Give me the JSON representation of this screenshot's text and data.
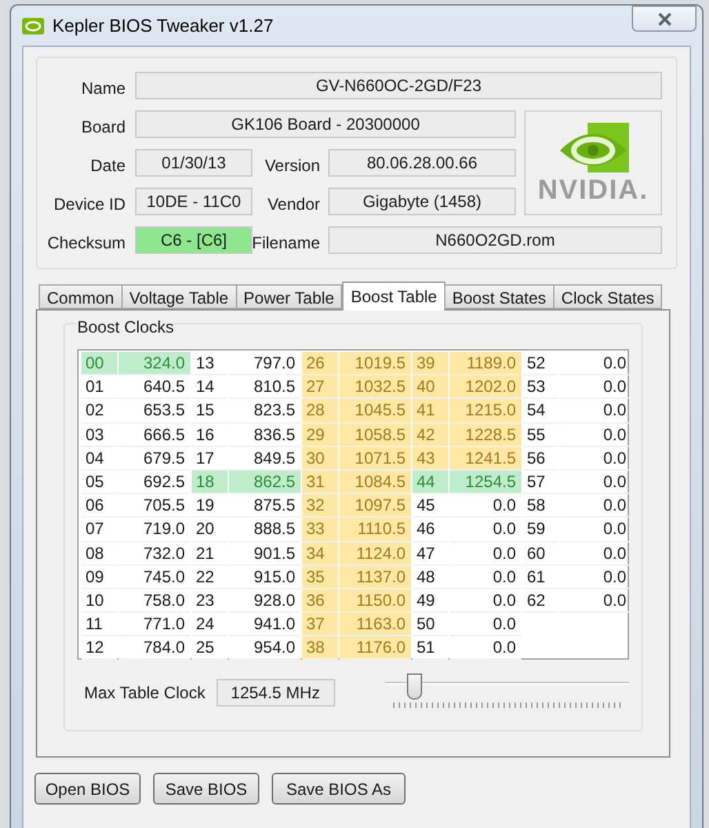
{
  "window": {
    "title": "Kepler BIOS Tweaker v1.27"
  },
  "info": {
    "name": {
      "label": "Name",
      "value": "GV-N660OC-2GD/F23"
    },
    "board": {
      "label": "Board",
      "value": "GK106 Board - 20300000"
    },
    "date": {
      "label": "Date",
      "value": "01/30/13"
    },
    "version": {
      "label": "Version",
      "value": "80.06.28.00.66"
    },
    "device_id": {
      "label": "Device ID",
      "value": "10DE - 11C0"
    },
    "vendor": {
      "label": "Vendor",
      "value": "Gigabyte (1458)"
    },
    "checksum": {
      "label": "Checksum",
      "value": "C6 - [C6]",
      "color": "#8ee68e"
    },
    "filename": {
      "label": "Filename",
      "value": "N660O2GD.rom"
    },
    "logo": {
      "text": "NVIDIA."
    }
  },
  "tabs": [
    {
      "label": "Common",
      "selected": false
    },
    {
      "label": "Voltage Table",
      "selected": false
    },
    {
      "label": "Power Table",
      "selected": false
    },
    {
      "label": "Boost Table",
      "selected": true
    },
    {
      "label": "Boost States",
      "selected": false
    },
    {
      "label": "Clock States",
      "selected": false
    }
  ],
  "boost_clocks": {
    "title": "Boost Clocks",
    "columns": [
      [
        {
          "index": "00",
          "value": "324.0",
          "color": "#bfeccb"
        },
        {
          "index": "01",
          "value": "640.5"
        },
        {
          "index": "02",
          "value": "653.5"
        },
        {
          "index": "03",
          "value": "666.5"
        },
        {
          "index": "04",
          "value": "679.5"
        },
        {
          "index": "05",
          "value": "692.5"
        },
        {
          "index": "06",
          "value": "705.5"
        },
        {
          "index": "07",
          "value": "719.0"
        },
        {
          "index": "08",
          "value": "732.0"
        },
        {
          "index": "09",
          "value": "745.0"
        },
        {
          "index": "10",
          "value": "758.0"
        },
        {
          "index": "11",
          "value": "771.0"
        },
        {
          "index": "12",
          "value": "784.0"
        }
      ],
      [
        {
          "index": "13",
          "value": "797.0"
        },
        {
          "index": "14",
          "value": "810.5"
        },
        {
          "index": "15",
          "value": "823.5"
        },
        {
          "index": "16",
          "value": "836.5"
        },
        {
          "index": "17",
          "value": "849.5"
        },
        {
          "index": "18",
          "value": "862.5",
          "color": "#bfeccb"
        },
        {
          "index": "19",
          "value": "875.5"
        },
        {
          "index": "20",
          "value": "888.5"
        },
        {
          "index": "21",
          "value": "901.5"
        },
        {
          "index": "22",
          "value": "915.0"
        },
        {
          "index": "23",
          "value": "928.0"
        },
        {
          "index": "24",
          "value": "941.0"
        },
        {
          "index": "25",
          "value": "954.0"
        }
      ],
      [
        {
          "index": "26",
          "value": "1019.5",
          "color": "#fde7a2"
        },
        {
          "index": "27",
          "value": "1032.5",
          "color": "#fde7a2"
        },
        {
          "index": "28",
          "value": "1045.5",
          "color": "#fde7a2"
        },
        {
          "index": "29",
          "value": "1058.5",
          "color": "#fde7a2"
        },
        {
          "index": "30",
          "value": "1071.5",
          "color": "#fde7a2"
        },
        {
          "index": "31",
          "value": "1084.5",
          "color": "#fde7a2"
        },
        {
          "index": "32",
          "value": "1097.5",
          "color": "#fde7a2"
        },
        {
          "index": "33",
          "value": "1110.5",
          "color": "#fde7a2"
        },
        {
          "index": "34",
          "value": "1124.0",
          "color": "#fde7a2"
        },
        {
          "index": "35",
          "value": "1137.0",
          "color": "#fde7a2"
        },
        {
          "index": "36",
          "value": "1150.0",
          "color": "#fde7a2"
        },
        {
          "index": "37",
          "value": "1163.0",
          "color": "#fde7a2"
        },
        {
          "index": "38",
          "value": "1176.0",
          "color": "#fde7a2"
        }
      ],
      [
        {
          "index": "39",
          "value": "1189.0",
          "color": "#fde7a2"
        },
        {
          "index": "40",
          "value": "1202.0",
          "color": "#fde7a2"
        },
        {
          "index": "41",
          "value": "1215.0",
          "color": "#fde7a2"
        },
        {
          "index": "42",
          "value": "1228.5",
          "color": "#fde7a2"
        },
        {
          "index": "43",
          "value": "1241.5",
          "color": "#fde7a2"
        },
        {
          "index": "44",
          "value": "1254.5",
          "color": "#bfeccb"
        },
        {
          "index": "45",
          "value": "0.0"
        },
        {
          "index": "46",
          "value": "0.0"
        },
        {
          "index": "47",
          "value": "0.0"
        },
        {
          "index": "48",
          "value": "0.0"
        },
        {
          "index": "49",
          "value": "0.0"
        },
        {
          "index": "50",
          "value": "0.0"
        },
        {
          "index": "51",
          "value": "0.0"
        }
      ],
      [
        {
          "index": "52",
          "value": "0.0"
        },
        {
          "index": "53",
          "value": "0.0"
        },
        {
          "index": "54",
          "value": "0.0"
        },
        {
          "index": "55",
          "value": "0.0"
        },
        {
          "index": "56",
          "value": "0.0"
        },
        {
          "index": "57",
          "value": "0.0"
        },
        {
          "index": "58",
          "value": "0.0"
        },
        {
          "index": "59",
          "value": "0.0"
        },
        {
          "index": "60",
          "value": "0.0"
        },
        {
          "index": "61",
          "value": "0.0"
        },
        {
          "index": "62",
          "value": "0.0"
        }
      ]
    ],
    "max_clock": {
      "label": "Max Table Clock",
      "value": "1254.5 MHz"
    },
    "slider": {
      "level": 0.1
    }
  },
  "buttons": [
    "Open BIOS",
    "Save BIOS",
    "Save BIOS As"
  ]
}
